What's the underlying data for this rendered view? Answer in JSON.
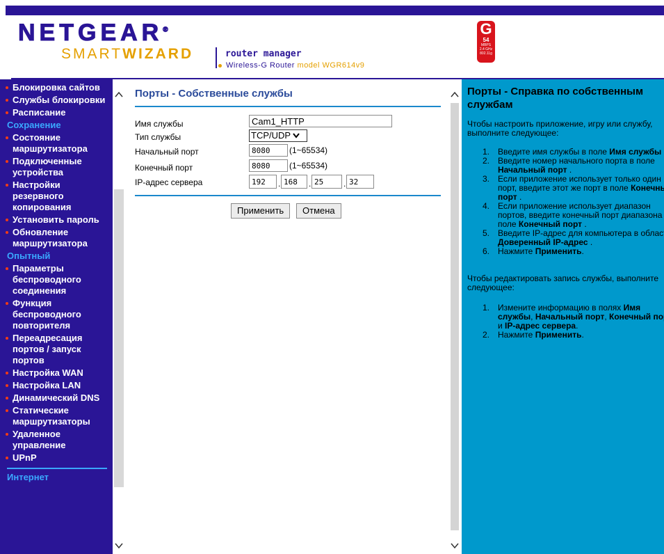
{
  "header": {
    "brand": "NETGEAR",
    "brand_mark": "®",
    "smart": "SMART",
    "wizard": "WIZARD",
    "router_manager": "router manager",
    "router_line": "Wireless-G Router",
    "model_label": "model WGR614v9",
    "badge_letter": "G",
    "badge_speed": "54",
    "badge_unit": "MBPS",
    "badge_band": "2.4 GHz",
    "badge_std": "802.11g"
  },
  "sidebar": {
    "items": [
      {
        "label": "Блокировка сайтов",
        "type": "item"
      },
      {
        "label": "Службы блокировки",
        "type": "item"
      },
      {
        "label": "Расписание",
        "type": "item"
      },
      {
        "label": "Сохранение",
        "type": "section"
      },
      {
        "label": "Состояние маршрутизатора",
        "type": "item"
      },
      {
        "label": "Подключенные устройства",
        "type": "item"
      },
      {
        "label": "Настройки резервного копирования",
        "type": "item"
      },
      {
        "label": "Установить пароль",
        "type": "item"
      },
      {
        "label": "Обновление маршрутизатора",
        "type": "item"
      },
      {
        "label": "Опытный",
        "type": "section"
      },
      {
        "label": "Параметры беспроводного соединения",
        "type": "item"
      },
      {
        "label": "Функция беспроводного повторителя",
        "type": "item"
      },
      {
        "label": "Переадресация портов / запуск портов",
        "type": "item"
      },
      {
        "label": "Настройка WAN",
        "type": "item"
      },
      {
        "label": "Настройка LAN",
        "type": "item"
      },
      {
        "label": "Динамический DNS",
        "type": "item"
      },
      {
        "label": "Статические маршрутизаторы",
        "type": "item"
      },
      {
        "label": "Удаленное управление",
        "type": "item"
      },
      {
        "label": "UPnP",
        "type": "item"
      },
      {
        "label": "Интернет",
        "type": "section"
      }
    ]
  },
  "main": {
    "title": "Порты - Собственные службы",
    "service_name_label": "Имя службы",
    "service_name_value": "Cam1_HTTP",
    "service_type_label": "Тип службы",
    "service_type_value": "TCP/UDP",
    "start_port_label": "Начальный порт",
    "start_port_value": "8080",
    "start_port_range": "(1~65534)",
    "end_port_label": "Конечный порт",
    "end_port_value": "8080",
    "end_port_range": "(1~65534)",
    "server_ip_label": "IP-адрес сервера",
    "ip1": "192",
    "ip2": "168",
    "ip3": "25",
    "ip4": "32",
    "apply_label": "Применить",
    "cancel_label": "Отмена"
  },
  "help": {
    "title": "Порты - Справка по собственным службам",
    "intro": "Чтобы настроить приложение, игру или службу, выполните следующее:",
    "steps": [
      {
        "n": "1.",
        "html": "Введите имя службы в поле <b>Имя службы</b>"
      },
      {
        "n": "2.",
        "html": "Введите номер начального порта в поле <b>Начальный порт</b> ."
      },
      {
        "n": "3.",
        "html": "Если приложение использует только один порт, введите этот же порт в поле <b>Конечный порт</b> ."
      },
      {
        "n": "4.",
        "html": "Если приложение использует диапазон портов, введите конечный порт диапазона в поле <b>Конечный порт</b> ."
      },
      {
        "n": "5.",
        "html": "Введите IP-адрес для компьютера в области <b>Доверенный IP-адрес</b> ."
      },
      {
        "n": "6.",
        "html": "Нажмите <b>Применить</b>."
      }
    ],
    "edit_intro": "Чтобы редактировать запись службы, выполните следующее:",
    "edit_steps": [
      {
        "n": "1.",
        "html": "Измените информацию в полях <b>Имя службы</b>, <b>Начальный порт</b>, <b>Конечный порт</b> и <b>IP-адрес сервера</b>."
      },
      {
        "n": "2.",
        "html": "Нажмите <b>Применить</b>."
      }
    ]
  },
  "colors": {
    "brand_purple": "#2a1596",
    "accent_orange": "#e5a000",
    "help_blue": "#0099cc",
    "section_blue": "#3aa8ff",
    "bullet_red": "#f23c14"
  }
}
